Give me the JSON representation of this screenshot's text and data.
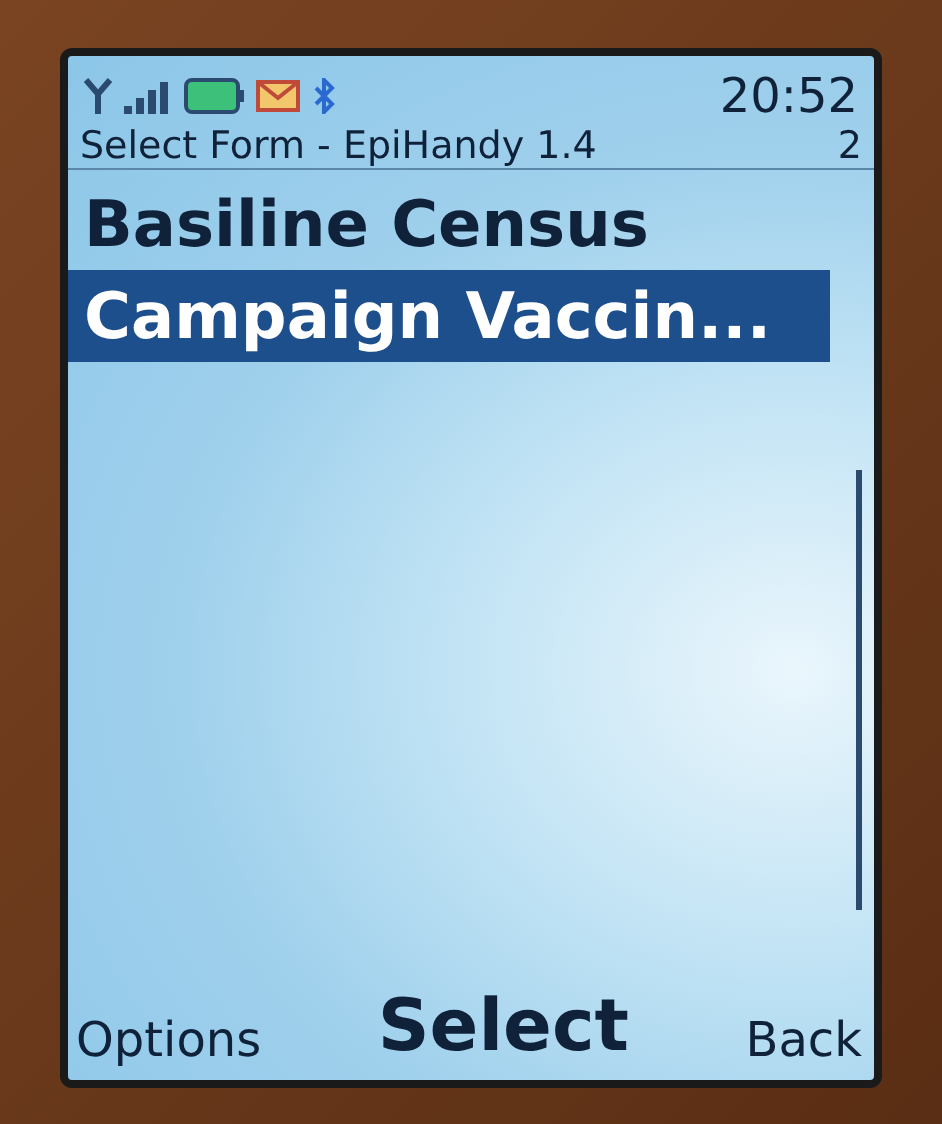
{
  "status_bar": {
    "time": "20:52"
  },
  "header": {
    "title": "Select Form - EpiHandy 1.4",
    "page": "2"
  },
  "list": [
    {
      "label": "Basiline Census",
      "selected": false
    },
    {
      "label": "Campaign Vaccin...",
      "selected": true
    }
  ],
  "softkeys": {
    "left": "Options",
    "center": "Select",
    "right": "Back"
  }
}
